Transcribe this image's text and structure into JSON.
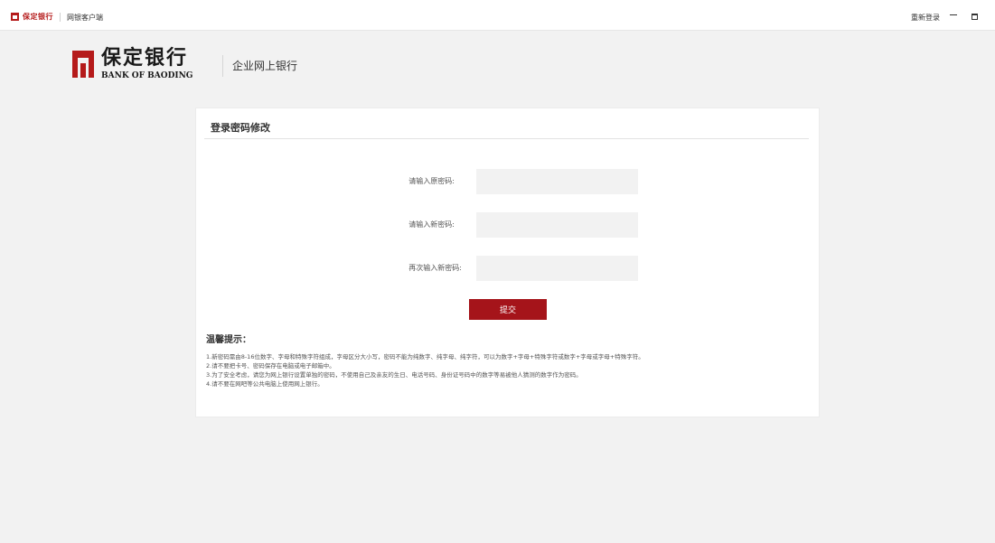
{
  "titlebar": {
    "logo_text": "保定银行",
    "app_name": "网银客户端",
    "relogin_label": "重新登录",
    "minimize_icon": "minimize-icon",
    "maximize_icon": "maximize-icon"
  },
  "brand": {
    "name_cn": "保定银行",
    "name_en": "BANK OF BAODING",
    "subtitle": "企业网上银行",
    "logo_color": "#b51a1a"
  },
  "form": {
    "title": "登录密码修改",
    "fields": [
      {
        "label": "请输入原密码:",
        "value": ""
      },
      {
        "label": "请输入新密码:",
        "value": ""
      },
      {
        "label": "再次输入新密码:",
        "value": ""
      }
    ],
    "submit_label": "提交",
    "submit_color": "#a5141a"
  },
  "tips": {
    "title": "温馨提示：",
    "items": [
      "1.新密码需由8-16位数字、字母和特殊字符组成，字母区分大小写，密码不能为纯数字、纯字母、纯字符，可以为数字+字母+特殊字符或数字+字母或字母+特殊字符。",
      "2.请不要把卡号、密码保存在电脑或电子邮箱中。",
      "3.为了安全考虑，请您为网上银行设置单独的密码，不使用自己及亲友的生日、电话号码、身份证号码中的数字等易被他人猜测的数字作为密码。",
      "4.请不要在网吧等公共电脑上使用网上银行。"
    ]
  }
}
